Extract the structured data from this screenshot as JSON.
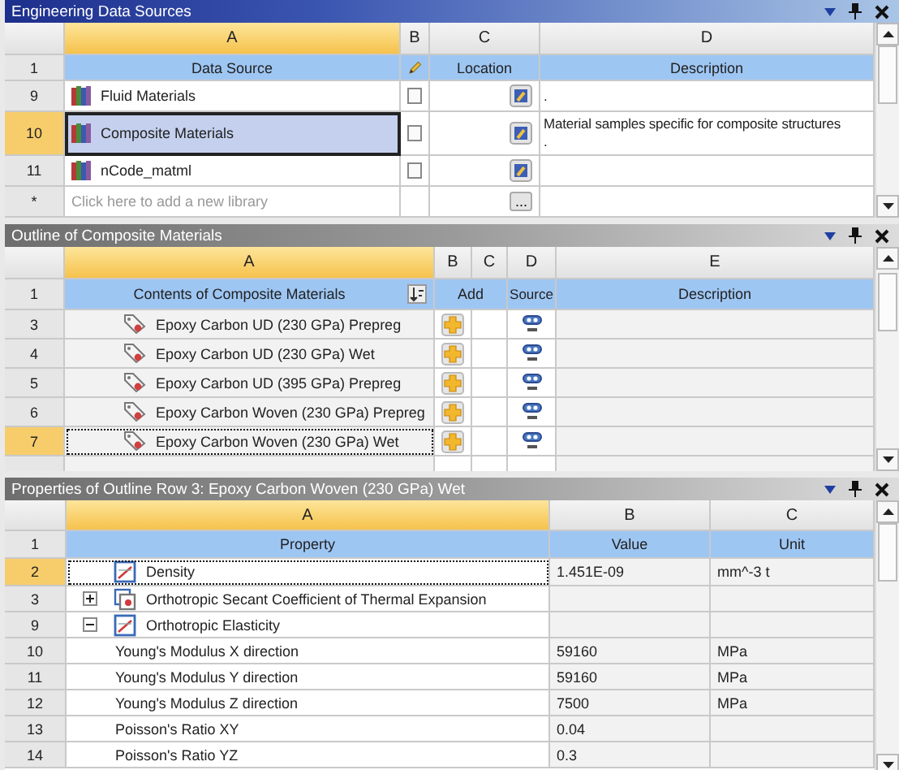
{
  "engineering_data_sources": {
    "title": "Engineering Data Sources",
    "columns": [
      {
        "label": "A",
        "selected": true
      },
      {
        "label": "B",
        "selected": false
      },
      {
        "label": "C",
        "selected": false
      },
      {
        "label": "D",
        "selected": false
      }
    ],
    "header": {
      "row": "1",
      "data_source": "Data Source",
      "location": "Location",
      "description": "Description"
    },
    "rows": [
      {
        "row": "9",
        "name": "Fluid Materials",
        "checked": false,
        "selected": false,
        "description": [
          "."
        ]
      },
      {
        "row": "10",
        "name": "Composite Materials",
        "checked": false,
        "selected": true,
        "description": [
          "Material samples specific for composite structures",
          "."
        ]
      },
      {
        "row": "11",
        "name": "nCode_matml",
        "checked": false,
        "selected": false,
        "description": []
      }
    ],
    "new_row": {
      "row": "*",
      "placeholder": "Click here to add a new library",
      "browse": "..."
    }
  },
  "outline": {
    "title": "Outline of Composite Materials",
    "columns": [
      {
        "label": "A",
        "selected": true
      },
      {
        "label": "B",
        "selected": false
      },
      {
        "label": "C",
        "selected": false
      },
      {
        "label": "D",
        "selected": false
      },
      {
        "label": "E",
        "selected": false
      }
    ],
    "header": {
      "row": "1",
      "contents": "Contents of Composite Materials",
      "add": "Add",
      "source": "Source",
      "description": "Description"
    },
    "rows": [
      {
        "row": "3",
        "name": "Epoxy Carbon UD (230 GPa) Prepreg",
        "selected": false
      },
      {
        "row": "4",
        "name": "Epoxy Carbon UD (230 GPa) Wet",
        "selected": false
      },
      {
        "row": "5",
        "name": "Epoxy Carbon UD (395 GPa) Prepreg",
        "selected": false
      },
      {
        "row": "6",
        "name": "Epoxy Carbon Woven (230 GPa) Prepreg",
        "selected": false
      },
      {
        "row": "7",
        "name": "Epoxy Carbon Woven (230 GPa) Wet",
        "selected": true
      }
    ]
  },
  "properties": {
    "title": "Properties of Outline Row 3: Epoxy Carbon Woven (230 GPa) Wet",
    "columns": [
      {
        "label": "A",
        "selected": true
      },
      {
        "label": "B",
        "selected": false
      },
      {
        "label": "C",
        "selected": false
      }
    ],
    "header": {
      "row": "1",
      "property": "Property",
      "value": "Value",
      "unit": "Unit"
    },
    "rows": [
      {
        "row": "2",
        "name": "Density",
        "value": "1.451E-09",
        "unit": "mm^-3 t",
        "selected": true
      },
      {
        "row": "3",
        "name": "Orthotropic Secant Coefficient of Thermal Expansion",
        "selected": false,
        "expanded": false
      },
      {
        "row": "9",
        "name": "Orthotropic Elasticity",
        "selected": false,
        "expanded": true,
        "children": [
          {
            "row": "10",
            "name": "Young's Modulus X direction",
            "value": "59160",
            "unit": "MPa",
            "selected": false
          },
          {
            "row": "11",
            "name": "Young's Modulus Y direction",
            "value": "59160",
            "unit": "MPa",
            "selected": false
          },
          {
            "row": "12",
            "name": "Young's Modulus Z direction",
            "value": "7500",
            "unit": "MPa",
            "selected": false
          },
          {
            "row": "13",
            "name": "Poisson's Ratio XY",
            "value": "0.04",
            "selected": false
          },
          {
            "row": "14",
            "name": "Poisson's Ratio YZ",
            "value": "0.3",
            "selected": false
          }
        ]
      }
    ]
  }
}
